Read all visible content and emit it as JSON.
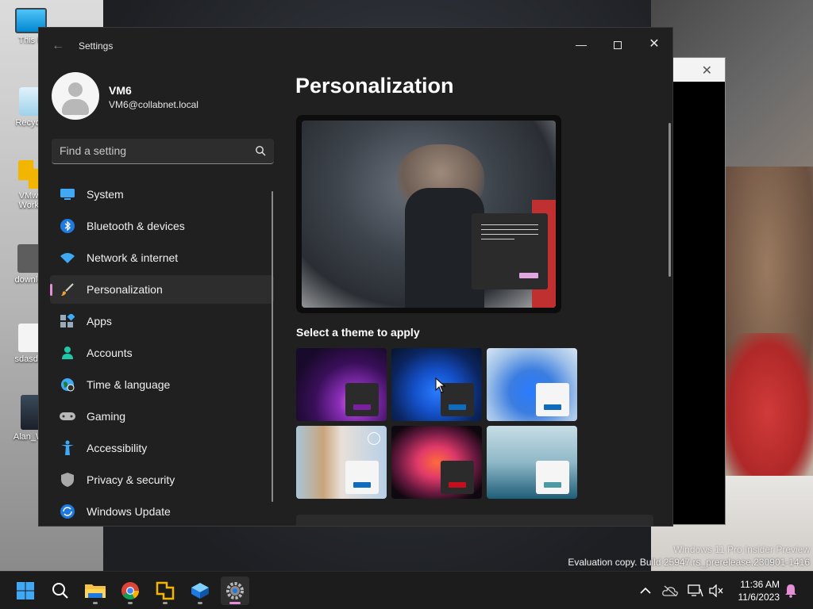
{
  "desktop": {
    "icons": [
      {
        "label": "This P"
      },
      {
        "label": "Recycle"
      },
      {
        "label": "VMwa\nWorks"
      },
      {
        "label": "downloa"
      },
      {
        "label": "sdasdas"
      },
      {
        "label": "Alan_Wa"
      }
    ]
  },
  "settings_window": {
    "title": "Settings",
    "profile": {
      "name": "VM6",
      "email": "VM6@collabnet.local"
    },
    "search": {
      "placeholder": "Find a setting"
    },
    "nav": [
      {
        "label": "System",
        "icon": "monitor-icon",
        "active": false
      },
      {
        "label": "Bluetooth & devices",
        "icon": "bluetooth-icon",
        "active": false
      },
      {
        "label": "Network & internet",
        "icon": "wifi-icon",
        "active": false
      },
      {
        "label": "Personalization",
        "icon": "paintbrush-icon",
        "active": true
      },
      {
        "label": "Apps",
        "icon": "apps-icon",
        "active": false
      },
      {
        "label": "Accounts",
        "icon": "person-icon",
        "active": false
      },
      {
        "label": "Time & language",
        "icon": "globe-clock-icon",
        "active": false
      },
      {
        "label": "Gaming",
        "icon": "gamepad-icon",
        "active": false
      },
      {
        "label": "Accessibility",
        "icon": "accessibility-icon",
        "active": false
      },
      {
        "label": "Privacy & security",
        "icon": "shield-icon",
        "active": false
      },
      {
        "label": "Windows Update",
        "icon": "update-icon",
        "active": false
      }
    ],
    "main": {
      "title": "Personalization",
      "theme_section_label": "Select a theme to apply",
      "themes": [
        {
          "name": "theme-purple-glow",
          "accent": "#7a1fa0"
        },
        {
          "name": "theme-windows-dark",
          "accent": "#0f6cbd"
        },
        {
          "name": "theme-windows-light",
          "accent": "#0f6cbd"
        },
        {
          "name": "theme-flowers-custom",
          "accent": "#0f6cbd"
        },
        {
          "name": "theme-captured-motion",
          "accent": "#c50f1f"
        },
        {
          "name": "theme-sunrise-lake",
          "accent": "#4a9aa8"
        }
      ]
    }
  },
  "watermark": {
    "line1": "Windows 11 Pro Insider Preview",
    "line2": "Evaluation copy. Build 25947.rs_prerelease.230901-1416"
  },
  "taskbar": {
    "apps": [
      {
        "name": "start-button",
        "icon": "windows-logo-icon"
      },
      {
        "name": "search-button",
        "icon": "search-icon"
      },
      {
        "name": "file-explorer-button",
        "icon": "folder-icon"
      },
      {
        "name": "chrome-button",
        "icon": "chrome-icon"
      },
      {
        "name": "vmware-button",
        "icon": "vmware-icon"
      },
      {
        "name": "app-store-button",
        "icon": "cube-icon"
      },
      {
        "name": "settings-button",
        "icon": "gear-icon"
      }
    ],
    "clock": {
      "time": "11:36 AM",
      "date": "11/6/2023"
    }
  },
  "colors": {
    "accent": "#e58fd6",
    "window_bg": "#202020",
    "nav_active": "#2d2d2d"
  }
}
